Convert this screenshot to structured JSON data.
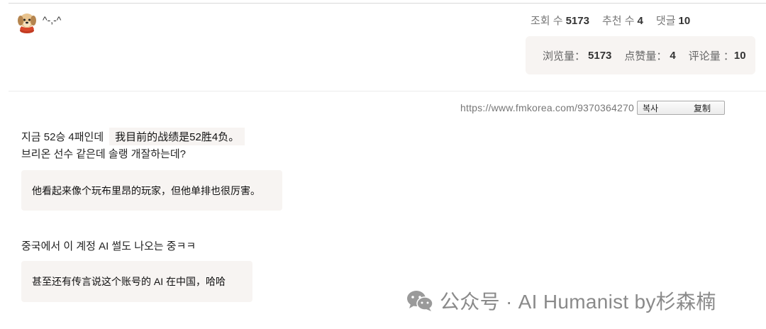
{
  "post": {
    "author": "^-,-^",
    "stats_ko": [
      {
        "label": "조회 수",
        "value": "5173"
      },
      {
        "label": "추천 수",
        "value": "4"
      },
      {
        "label": "댓글",
        "value": "10"
      }
    ],
    "stats_zh": [
      {
        "label": "浏览量：",
        "value": "5173"
      },
      {
        "label": "点赞量：",
        "value": "4"
      },
      {
        "label": "评论量 ：",
        "value": "10"
      }
    ],
    "url": "https://www.fmkorea.com/9370364270",
    "copy_ko": "복사",
    "copy_zh": "复制"
  },
  "content": {
    "line1_ko": "지금 52승 4패인데",
    "line1_zh": "我目前的战绩是52胜4负。",
    "line2_ko": "브리온 선수 같은데 솔랭 개잘하는데?",
    "line2_zh": "他看起来像个玩布里昂的玩家，但他单排也很厉害。",
    "line3_ko": "중국에서 이 계정 AI 썰도 나오는 중ㅋㅋ",
    "line3_zh": "甚至还有传言说这个账号的 AI 在中国，哈哈"
  },
  "watermark": {
    "text": "公众号 · AI Humanist by杉森楠",
    "icon": "wechat-icon"
  }
}
